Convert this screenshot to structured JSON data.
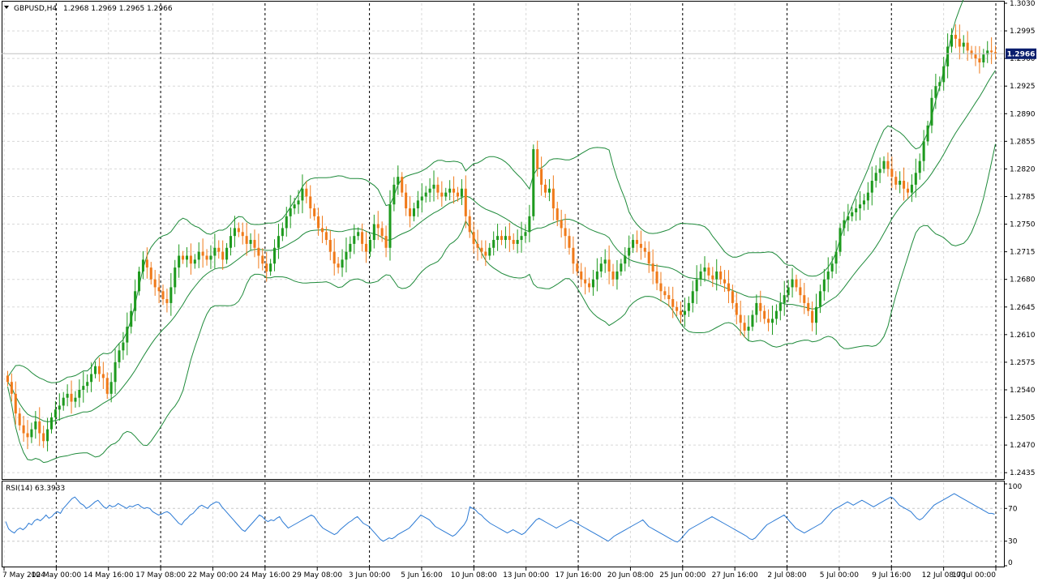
{
  "header": {
    "symbol_label": "GBPUSD,H4",
    "ohlc": "1.2968 1.2969 1.2965 1.2966"
  },
  "rsi": {
    "label": "RSI(14) 63.3933",
    "period": 14,
    "levels": [
      70,
      30
    ],
    "axis_ticks": [
      "100",
      "70",
      "30",
      "0"
    ],
    "color": "#2a79d4",
    "values": [
      54,
      45,
      42,
      40,
      44,
      46,
      44,
      47,
      52,
      50,
      55,
      57,
      55,
      58,
      62,
      58,
      60,
      64,
      66,
      64,
      70,
      74,
      78,
      82,
      84,
      80,
      76,
      74,
      70,
      72,
      75,
      78,
      80,
      76,
      72,
      70,
      74,
      72,
      73,
      76,
      74,
      72,
      70,
      73,
      72,
      74,
      75,
      72,
      70,
      71,
      70,
      66,
      64,
      62,
      63,
      65,
      66,
      64,
      60,
      56,
      52,
      50,
      55,
      58,
      62,
      64,
      68,
      72,
      74,
      72,
      70,
      74,
      76,
      78,
      77,
      72,
      68,
      64,
      60,
      56,
      52,
      48,
      44,
      42,
      46,
      50,
      54,
      58,
      62,
      60,
      56,
      54,
      56,
      55,
      58,
      60,
      54,
      50,
      46,
      48,
      50,
      52,
      54,
      56,
      58,
      60,
      62,
      60,
      55,
      50,
      46,
      44,
      42,
      40,
      38,
      40,
      44,
      47,
      50,
      53,
      55,
      58,
      60,
      56,
      52,
      50,
      48,
      44,
      40,
      36,
      32,
      30,
      32,
      34,
      33,
      35,
      38,
      40,
      42,
      44,
      46,
      50,
      54,
      58,
      62,
      60,
      58,
      56,
      52,
      48,
      46,
      44,
      42,
      40,
      38,
      36,
      38,
      42,
      46,
      50,
      56,
      72,
      70,
      68,
      64,
      62,
      58,
      55,
      52,
      50,
      48,
      46,
      44,
      42,
      40,
      42,
      44,
      42,
      40,
      38,
      40,
      44,
      48,
      52,
      56,
      58,
      56,
      54,
      52,
      50,
      48,
      46,
      48,
      50,
      52,
      54,
      56,
      54,
      52,
      50,
      48,
      46,
      44,
      42,
      40,
      38,
      36,
      34,
      32,
      30,
      33,
      36,
      38,
      40,
      42,
      44,
      46,
      48,
      50,
      52,
      54,
      56,
      52,
      48,
      46,
      44,
      42,
      40,
      38,
      36,
      34,
      32,
      30,
      29,
      32,
      36,
      40,
      44,
      46,
      48,
      50,
      52,
      54,
      56,
      58,
      60,
      58,
      56,
      54,
      52,
      50,
      48,
      46,
      44,
      42,
      40,
      38,
      36,
      33,
      32,
      34,
      38,
      42,
      46,
      50,
      52,
      54,
      56,
      58,
      60,
      62,
      58,
      54,
      50,
      46,
      44,
      42,
      40,
      42,
      44,
      46,
      48,
      50,
      52,
      56,
      60,
      64,
      68,
      70,
      72,
      74,
      76,
      78,
      76,
      74,
      76,
      78,
      80,
      78,
      76,
      74,
      72,
      74,
      76,
      78,
      80,
      82,
      84,
      82,
      78,
      74,
      72,
      70,
      68,
      66,
      62,
      58,
      56,
      58,
      62,
      66,
      70,
      74,
      76,
      78,
      80,
      82,
      84,
      86,
      88,
      86,
      84,
      82,
      80,
      78,
      76,
      74,
      72,
      70,
      68,
      66,
      64,
      64,
      63
    ]
  },
  "chart_data": {
    "type": "candlestick",
    "symbol": "GBPUSD",
    "timeframe": "H4",
    "last_price": "1.2966",
    "ylim": [
      1.2428,
      1.303
    ],
    "y_ticks": [
      "1.3030",
      "1.2995",
      "1.2960",
      "1.2925",
      "1.2890",
      "1.2855",
      "1.2820",
      "1.2785",
      "1.2750",
      "1.2715",
      "1.2680",
      "1.2645",
      "1.2610",
      "1.2575",
      "1.2540",
      "1.2505",
      "1.2470",
      "1.2435"
    ],
    "x_labels": [
      "7 May 2024",
      "10 May 00:00",
      "14 May 16:00",
      "17 May 08:00",
      "22 May 00:00",
      "24 May 16:00",
      "29 May 08:00",
      "3 Jun 00:00",
      "5 Jun 16:00",
      "10 Jun 08:00",
      "13 Jun 00:00",
      "17 Jun 16:00",
      "20 Jun 08:00",
      "25 Jun 00:00",
      "27 Jun 16:00",
      "2 Jul 08:00",
      "5 Jul 00:00",
      "9 Jul 16:00",
      "12 Jul 08:00",
      "17 Jul 00:00"
    ],
    "day_separator_count": 10,
    "bull_color": "#1e9a1e",
    "bear_color": "#f07a1a",
    "band_color": "#1e8a3a",
    "closes": [
      1.255,
      1.2535,
      1.251,
      1.2495,
      1.2485,
      1.248,
      1.249,
      1.25,
      1.2485,
      1.2475,
      1.249,
      1.2505,
      1.2515,
      1.252,
      1.253,
      1.2535,
      1.2525,
      1.253,
      1.254,
      1.2545,
      1.255,
      1.256,
      1.257,
      1.256,
      1.2555,
      1.2535,
      1.255,
      1.2575,
      1.259,
      1.26,
      1.262,
      1.264,
      1.2665,
      1.269,
      1.2705,
      1.2695,
      1.268,
      1.267,
      1.2665,
      1.2655,
      1.265,
      1.267,
      1.2695,
      1.271,
      1.2705,
      1.271,
      1.27,
      1.2705,
      1.2715,
      1.271,
      1.2705,
      1.271,
      1.272,
      1.2715,
      1.2705,
      1.272,
      1.2735,
      1.2745,
      1.274,
      1.2735,
      1.2725,
      1.273,
      1.272,
      1.271,
      1.27,
      1.269,
      1.27,
      1.272,
      1.2735,
      1.2745,
      1.276,
      1.277,
      1.2775,
      1.278,
      1.2795,
      1.2785,
      1.277,
      1.276,
      1.2745,
      1.274,
      1.273,
      1.2715,
      1.27,
      1.2695,
      1.2705,
      1.2715,
      1.2725,
      1.2735,
      1.274,
      1.2725,
      1.2715,
      1.273,
      1.275,
      1.2745,
      1.2735,
      1.272,
      1.2775,
      1.28,
      1.281,
      1.279,
      1.277,
      1.276,
      1.277,
      1.278,
      1.2785,
      1.279,
      1.2795,
      1.28,
      1.279,
      1.2785,
      1.279,
      1.2795,
      1.279,
      1.2785,
      1.2795,
      1.276,
      1.274,
      1.2725,
      1.272,
      1.2715,
      1.271,
      1.272,
      1.273,
      1.2735,
      1.273,
      1.2735,
      1.273,
      1.2725,
      1.273,
      1.2735,
      1.274,
      1.276,
      1.2845,
      1.282,
      1.28,
      1.279,
      1.2795,
      1.277,
      1.2755,
      1.2745,
      1.2735,
      1.272,
      1.27,
      1.269,
      1.268,
      1.2675,
      1.267,
      1.268,
      1.269,
      1.27,
      1.2705,
      1.269,
      1.268,
      1.269,
      1.27,
      1.271,
      1.272,
      1.273,
      1.2725,
      1.272,
      1.2715,
      1.27,
      1.269,
      1.2675,
      1.2665,
      1.266,
      1.2655,
      1.2645,
      1.264,
      1.2635,
      1.264,
      1.265,
      1.2665,
      1.268,
      1.269,
      1.2695,
      1.2685,
      1.268,
      1.269,
      1.268,
      1.2675,
      1.2665,
      1.265,
      1.2635,
      1.2625,
      1.2615,
      1.262,
      1.2635,
      1.265,
      1.264,
      1.263,
      1.2625,
      1.263,
      1.264,
      1.265,
      1.266,
      1.267,
      1.268,
      1.267,
      1.266,
      1.265,
      1.264,
      1.2625,
      1.2645,
      1.2665,
      1.268,
      1.269,
      1.27,
      1.2715,
      1.2745,
      1.2755,
      1.276,
      1.2765,
      1.277,
      1.2775,
      1.278,
      1.279,
      1.2805,
      1.2815,
      1.282,
      1.283,
      1.282,
      1.281,
      1.28,
      1.2805,
      1.2795,
      1.279,
      1.28,
      1.2815,
      1.283,
      1.2855,
      1.2875,
      1.291,
      1.2925,
      1.293,
      1.295,
      1.2975,
      1.299,
      1.2985,
      1.2975,
      1.298,
      1.297,
      1.2965,
      1.296,
      1.2955,
      1.2965,
      1.297,
      1.2968,
      1.2966
    ]
  }
}
